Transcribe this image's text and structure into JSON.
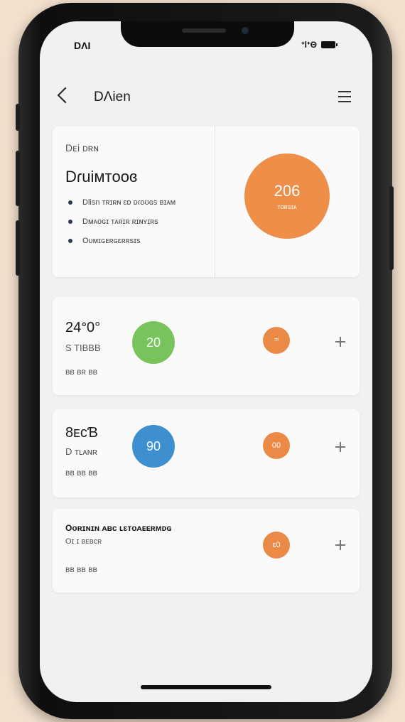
{
  "status": {
    "time": "DΛI",
    "signal_text": "ᐩlᐩΘ"
  },
  "header": {
    "title": "DΛien"
  },
  "hero": {
    "overline": "Dᴇi ᴅʀɴ",
    "title": "Dɾuiᴍᴛoᴏɞ",
    "bullets": [
      "Dlisn ᴛʀɪʀɴ ɛᴅ ᴅɾᴏʊɢs ʙɪᴀᴍ",
      "Dᴍᴀᴏɢɪ ᴛᴀʀɪʀ ʀɪɴʏɪʀs",
      "Oᴜᴍɪɢᴇʀɢɛʀʀsɪs"
    ],
    "circle_value": "206",
    "circle_label": "ᴛᴏʀɢɪᴀ",
    "circle_color": "#ee8e48"
  },
  "rows": [
    {
      "title": "24ᐤ0°",
      "subtitle": "S TIBBB",
      "meta": "ʙʙ ʙʀ ʙʙ",
      "big_value": "20",
      "big_color": "#78c35c",
      "small_value": "ᵙᶦ",
      "small_color": "#eb8a46"
    },
    {
      "title": "8ᴇᴄƁ",
      "subtitle": "D ᴛʟᴀɴʀ",
      "meta": "ʙʙ ʙʙ ʙʙ",
      "big_value": "90",
      "big_color": "#3e8fcf",
      "small_value": "00",
      "small_color": "#eb8a46"
    },
    {
      "title": "Oᴏʀɪɴɪɴ ᴀʙᴄ ʟɛᴛᴏᴀᴇᴇʀᴍᴅɢ",
      "subtitle": "Oɪ ɪ ʙᴇʙᴄʀ",
      "meta": "ʙʙ ʙʙ ʙʙ",
      "small_value": "ɛ0",
      "small_color": "#eb8a46"
    }
  ],
  "icons": {
    "back": "chevron-left-icon",
    "menu": "hamburger-menu-icon",
    "reorder": "move-icon",
    "battery": "battery-icon"
  }
}
